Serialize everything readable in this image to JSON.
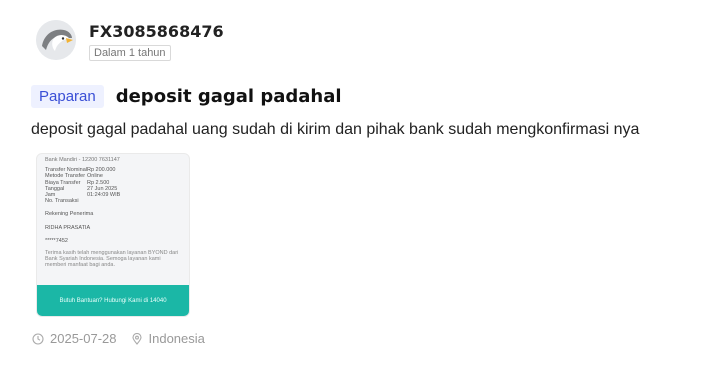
{
  "post": {
    "username": "FX3085868476",
    "time_badge": "Dalam 1 tahun",
    "tag": "Paparan",
    "title": "deposit gagal padahal",
    "body": "deposit gagal padahal uang sudah di kirim dan pihak bank sudah mengkonfirmasi nya",
    "date": "2025-07-28",
    "location": "Indonesia"
  },
  "attachment": {
    "bank_header": "Bank Mandiri - 12200 7631147",
    "rows": [
      {
        "k": "Transfer Nominal",
        "v": "Rp 200.000"
      },
      {
        "k": "Metode Transfer",
        "v": "Online"
      },
      {
        "k": "Biaya Transfer",
        "v": "Rp 2.500"
      },
      {
        "k": "Tanggal",
        "v": "27 Jun 2025"
      },
      {
        "k": "Jam",
        "v": "01:24:09 WIB"
      },
      {
        "k": "No. Transaksi",
        "v": ""
      }
    ],
    "recipient_label": "Rekening Penerima",
    "recipient_name": "RIDHA PRASATIA",
    "recipient_account": "*****7452",
    "note": "Terima kasih telah menggunakan layanan BYOND dari Bank Syariah Indonesia. Semoga layanan kami memberi manfaat bagi anda.",
    "cta": "Butuh Bantuan? Hubungi Kami di 14040"
  },
  "colors": {
    "tag_bg": "#eef1ff",
    "tag_text": "#3a4fd6",
    "cta_bg": "#1bb7a6"
  },
  "icons": {
    "date": "clock-icon",
    "location": "location-pin-icon"
  }
}
